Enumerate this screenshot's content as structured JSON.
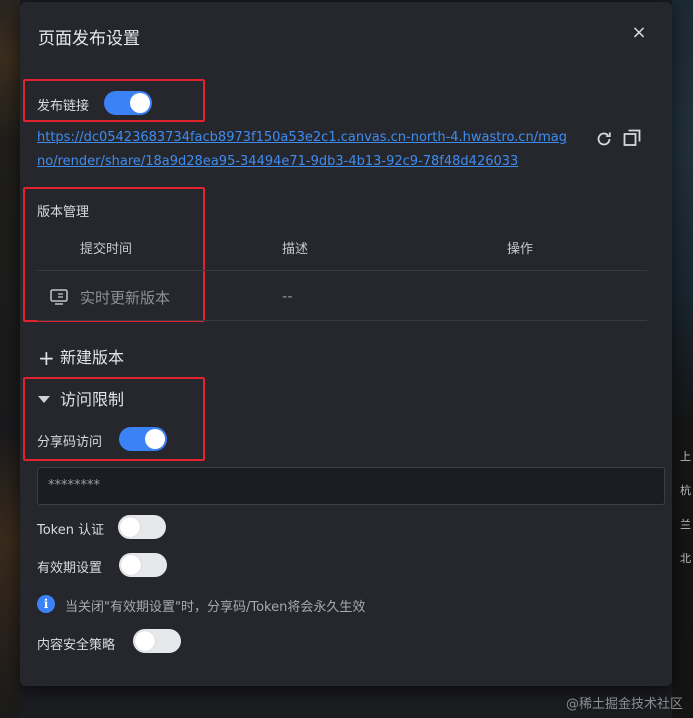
{
  "dialog": {
    "title": "页面发布设置",
    "close_symbol": "×"
  },
  "publish_link": {
    "label": "发布链接",
    "enabled": true,
    "url": "https://dc05423683734facb8973f150a53e2c1.canvas.cn-north-4.hwastro.cn/magno/render/share/18a9d28ea95-34494e71-9db3-4b13-92c9-78f48d426033"
  },
  "icons": {
    "refresh": "refresh-icon",
    "copy": "copy-icon",
    "monitor": "monitor-icon",
    "info": "info-icon"
  },
  "version": {
    "title": "版本管理",
    "columns": [
      "提交时间",
      "描述",
      "操作"
    ],
    "rows": [
      {
        "time": "实时更新版本",
        "desc": "--",
        "action": ""
      }
    ],
    "add_label": "新建版本",
    "add_symbol": "+"
  },
  "access": {
    "title": "访问限制",
    "share_code": {
      "label": "分享码访问",
      "enabled": true,
      "value": "********"
    },
    "token": {
      "label": "Token 认证",
      "enabled": false
    },
    "expiry": {
      "label": "有效期设置",
      "enabled": false
    },
    "hint": "当关闭\"有效期设置\"时，分享码/Token将会永久生效",
    "security": {
      "label": "内容安全策略",
      "enabled": false
    }
  },
  "background": {
    "right_labels": [
      "上",
      "杭",
      "兰",
      "北"
    ]
  },
  "watermark": "@稀土掘金技术社区",
  "colors": {
    "accent": "#3b82f6",
    "highlight_box": "#e0232d",
    "dialog_bg": "#26272d",
    "link": "#3f8cf0"
  }
}
